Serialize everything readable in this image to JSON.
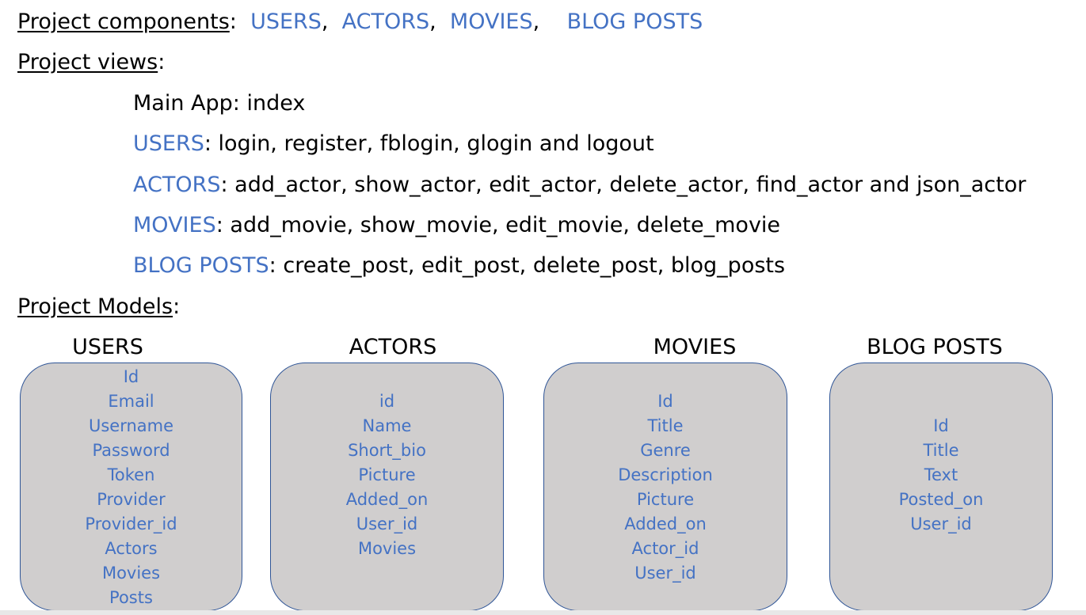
{
  "components": {
    "label": "Project components",
    "sep": ":",
    "items": [
      "USERS",
      "ACTORS",
      "MOVIES",
      "BLOG POSTS"
    ]
  },
  "views": {
    "label": "Project views",
    "sep": ":",
    "main": "Main App: index",
    "users": {
      "name": "USERS",
      "rest": ":  login, register, fblogin, glogin and logout"
    },
    "actors": {
      "name": "ACTORS",
      "rest": ": add_actor, show_actor, edit_actor, delete_actor, find_actor and json_actor"
    },
    "movies": {
      "name": "MOVIES",
      "rest": ": add_movie, show_movie, edit_movie, delete_movie"
    },
    "blog": {
      "name": "BLOG POSTS",
      "rest": ": create_post, edit_post, delete_post,  blog_posts"
    }
  },
  "models": {
    "label": "Project Models",
    "sep": ":",
    "cards": [
      {
        "title": "USERS",
        "fields": [
          "Id",
          "Email",
          "Username",
          "Password",
          "Token",
          "Provider",
          "Provider_id",
          "Actors",
          "Movies",
          "Posts"
        ]
      },
      {
        "title": "ACTORS",
        "fields": [
          "id",
          "Name",
          "Short_bio",
          "Picture",
          "Added_on",
          "User_id",
          "Movies"
        ]
      },
      {
        "title": "MOVIES",
        "fields": [
          "Id",
          "Title",
          "Genre",
          "Description",
          "Picture",
          "Added_on",
          "Actor_id",
          "User_id"
        ]
      },
      {
        "title": "BLOG POSTS",
        "fields": [
          "Id",
          "Title",
          "Text",
          "Posted_on",
          "User_id"
        ]
      }
    ]
  },
  "colors": {
    "accent": "#4472c4",
    "card_fill": "#d0cece",
    "card_border": "#2f5597"
  }
}
